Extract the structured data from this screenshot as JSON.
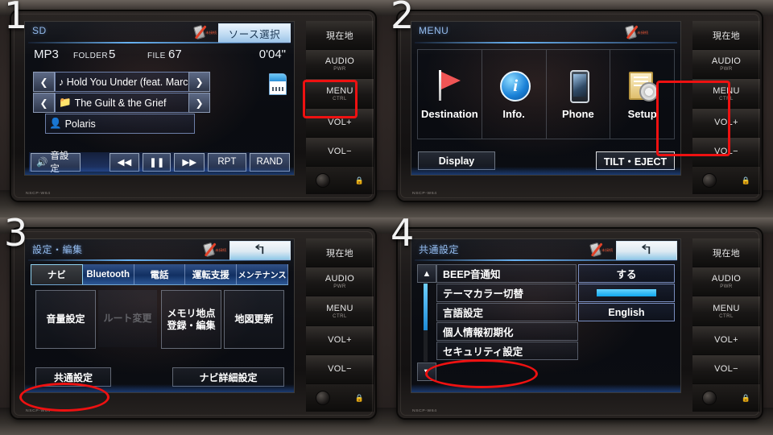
{
  "device": {
    "model_label": "NSCP-W64"
  },
  "hardkeys": [
    {
      "label": "現在地",
      "sub": ""
    },
    {
      "label": "AUDIO",
      "sub": "PWR"
    },
    {
      "label": "MENU",
      "sub": "CTRL"
    },
    {
      "label": "VOL+",
      "sub": ""
    },
    {
      "label": "VOL−",
      "sub": ""
    }
  ],
  "status_icon": {
    "name": "phone-disconnected-icon",
    "label": "未接続"
  },
  "panels": [
    {
      "number": "1",
      "title": "SD",
      "source_button": "ソース選択",
      "track_info": {
        "format": "MP3",
        "folder_label": "FOLDER",
        "folder_value": "5",
        "file_label": "FILE",
        "file_value": "67",
        "elapsed": "0'04\"",
        "title_row": "♪ Hold You Under (feat. Marcus Bri",
        "folder_row": "The Guilt & the Grief",
        "artist_row": "Polaris"
      },
      "controls": {
        "sound_settings": "音設定",
        "prev": "◀◀",
        "pause": "❚❚",
        "next": "▶▶",
        "repeat": "RPT",
        "random": "RAND"
      },
      "highlight_target": "MENU hard key"
    },
    {
      "number": "2",
      "title": "MENU",
      "menu_items": [
        {
          "label": "Destination",
          "icon": "flag-icon"
        },
        {
          "label": "Info.",
          "icon": "info-circle-icon"
        },
        {
          "label": "Phone",
          "icon": "phone-icon"
        },
        {
          "label": "Setup",
          "icon": "setup-gear-icon"
        }
      ],
      "display_button": "Display",
      "tilt_eject_button": "TILT・EJECT",
      "highlight_target": "Setup"
    },
    {
      "number": "3",
      "title": "設定・編集",
      "back_button": "↰",
      "tabs": [
        {
          "label": "ナビ",
          "active": true
        },
        {
          "label": "Bluetooth",
          "active": false
        },
        {
          "label": "電話",
          "active": false
        },
        {
          "label": "運転支援",
          "active": false
        },
        {
          "label": "メンテナンス",
          "active": false
        }
      ],
      "buttons": [
        {
          "label": "音量設定",
          "disabled": false
        },
        {
          "label": "ルート変更",
          "disabled": true
        },
        {
          "label": "メモリ地点\n登録・編集",
          "disabled": false
        },
        {
          "label": "地図更新",
          "disabled": false
        }
      ],
      "common_settings_button": "共通設定",
      "nav_detail_button": "ナビ詳細設定",
      "highlight_target": "共通設定"
    },
    {
      "number": "4",
      "title": "共通設定",
      "back_button": "↰",
      "scroll_up": "▲",
      "scroll_down": "▼",
      "rows": [
        {
          "label": "BEEP音通知",
          "value": "する",
          "value_type": "text"
        },
        {
          "label": "テーマカラー切替",
          "value": "",
          "value_type": "swatch"
        },
        {
          "label": "言語設定",
          "value": "English",
          "value_type": "text"
        },
        {
          "label": "個人情報初期化",
          "value": "",
          "value_type": "none"
        },
        {
          "label": "セキュリティ設定",
          "value": "",
          "value_type": "none"
        }
      ],
      "highlight_target": "セキュリティ設定"
    }
  ],
  "colors": {
    "highlight": "#ee1111",
    "accent_blue": "#6fb9ff",
    "panel_blue": "#8fb6e8"
  }
}
